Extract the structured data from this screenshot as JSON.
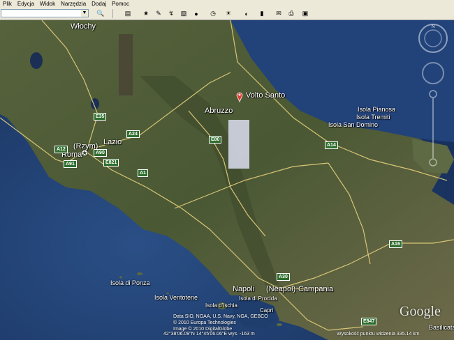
{
  "menu": [
    "Plik",
    "Edycja",
    "Widok",
    "Narzędzia",
    "Dodaj",
    "Pomoc"
  ],
  "labels": {
    "wlochy": "Włochy",
    "volto_santo": "Volto Santo",
    "abruzzo": "Abruzzo",
    "lazio": "Lazio",
    "rzym": "(Rzym)",
    "roma": "Roma",
    "isola_pianosa": "Isola Pianosa",
    "isola_tremiti": "Isola Tremiti",
    "isola_san_domino": "Isola San Domino",
    "isola_ponza": "Isola di Ponza",
    "isola_ventotene": "Isola Ventotene",
    "napoli": "Napoli",
    "neapol": "(Neapol)",
    "campania": "Campania",
    "isola_ischia": "Isola d'Ischia",
    "isola_procida": "Isola di Procida",
    "capri": "Capri",
    "basilicata": "Basilicata"
  },
  "roads": {
    "e35": "E35",
    "a24": "A24",
    "a12": "A12",
    "a90": "A90",
    "a91": "A91",
    "e821": "E821",
    "e80": "E80",
    "a1": "A1",
    "a14": "A14",
    "a16": "A16",
    "a30": "A30",
    "e847": "E847"
  },
  "credits": {
    "line1": "Data SIO, NOAA, U.S. Navy, NGA, GEBCO",
    "line2": "© 2010 Europa Technologies",
    "line3": "Image © 2010 DigitalGlobe"
  },
  "status": {
    "coords": "42°38'06.09\"N    14°45'06.06\"E  wys. -163 m",
    "altitude": "Wysokość punktu widzenia  335.14 km"
  },
  "logo": "Google",
  "colors": {
    "sea": "#1e3f70",
    "land": "#4c5a35",
    "road": "#e8d88a",
    "shield": "#2f6e2f"
  }
}
